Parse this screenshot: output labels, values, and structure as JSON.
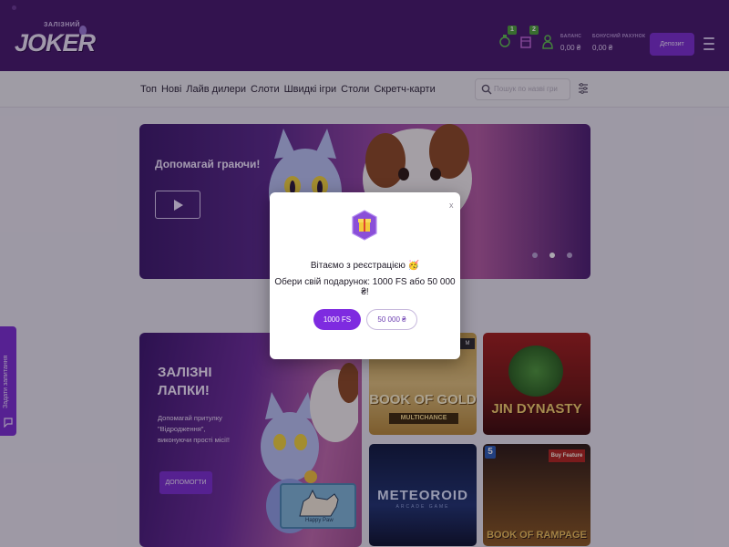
{
  "header": {
    "logo_small": "ЗАЛІЗНИЙ",
    "logo_big": "JOKER",
    "badge_1": "1",
    "badge_2": "2",
    "balance_label": "БАЛАНС",
    "balance_value": "0,00 ₴",
    "bonus_label": "БОНУСНИЙ РАХУНОК",
    "bonus_value": "0,00 ₴",
    "deposit_label": "Депозит"
  },
  "nav": {
    "items": [
      "Топ",
      "Нові",
      "Лайв дилери",
      "Слоти",
      "Швидкі ігри",
      "Столи",
      "Скретч-карти"
    ],
    "search_placeholder": "Пошук по назві гри"
  },
  "hero": {
    "title": "Допомагай граючи!",
    "slides": 3,
    "active_slide": 2
  },
  "promo": {
    "title_line1": "ЗАЛІЗНІ",
    "title_line2": "ЛАПКИ!",
    "description": "Допомагай притулку \"Відродження\", виконуючи прості місії!",
    "button_label": "ДОПОМОГТИ",
    "happy_paw_label": "Happy Paw"
  },
  "games": [
    {
      "name": "BOOK OF GOLD",
      "sub": "MULTICHANCE",
      "badge": "M"
    },
    {
      "name": "JIN DYNASTY"
    },
    {
      "name": "METEOROID",
      "sub": "ARCADE GAME"
    },
    {
      "name": "BOOK OF RAMPAGE",
      "badge": "5",
      "badge2": "Buy Feature"
    }
  ],
  "side_tab": {
    "label": "Задати запитання"
  },
  "modal": {
    "close": "x",
    "line1": "Вітаємо з реєстрацією 🥳",
    "line2": "Обери свій подарунок: 1000 FS або 50 000 ₴!",
    "option_fs": "1000 FS",
    "option_money": "50 000 ₴"
  },
  "colors": {
    "header_bg": "#46196b",
    "accent": "#7e2be0",
    "page_bg": "#e9e7ee"
  }
}
